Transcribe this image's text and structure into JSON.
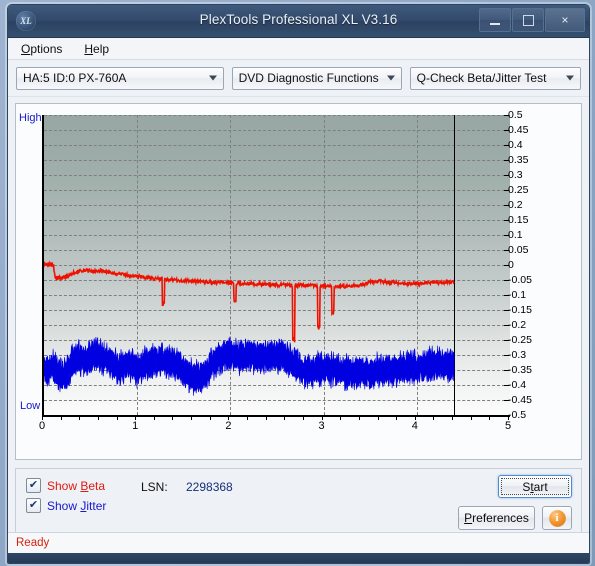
{
  "window": {
    "title": "PlexTools Professional XL V3.16",
    "logo_text": "XL",
    "minimize_label": "Minimize",
    "maximize_label": "Maximize",
    "close_label": "×"
  },
  "menu": {
    "items": [
      {
        "label": "Options",
        "mnemonic": "O"
      },
      {
        "label": "Help",
        "mnemonic": "H"
      }
    ]
  },
  "toolbar": {
    "drive_select": "HA:5 ID:0  PX-760A",
    "function_select": "DVD Diagnostic Functions",
    "test_select": "Q-Check Beta/Jitter Test"
  },
  "chart_labels": {
    "high": "High",
    "low": "Low"
  },
  "controls": {
    "show_beta_label": "Show Beta",
    "show_beta_mnemonic": "B",
    "show_beta_checked": "✔",
    "show_jitter_label": "Show Jitter",
    "show_jitter_mnemonic": "J",
    "show_jitter_checked": "✔",
    "lsn_label": "LSN:",
    "lsn_value": "2298368",
    "start_label": "Start",
    "start_mnemonic": "t",
    "preferences_label": "Preferences",
    "preferences_mnemonic": "P",
    "info_label": "i"
  },
  "status": {
    "text": "Ready"
  },
  "colors": {
    "beta": "#ee1100",
    "jitter": "#0000e0",
    "label_blue": "#1818cc",
    "status_red": "#d81f10",
    "titlebar": "#32496a"
  },
  "chart_data": {
    "type": "line",
    "title": "Q-Check Beta/Jitter Test",
    "xlabel": "",
    "ylabel": "",
    "xlim": [
      0,
      5
    ],
    "ylim": [
      -0.5,
      0.5
    ],
    "grid": true,
    "legend_position": "bottom-left",
    "y_ticks": [
      0.5,
      0.45,
      0.4,
      0.35,
      0.3,
      0.25,
      0.2,
      0.15,
      0.1,
      0.05,
      0,
      -0.05,
      -0.1,
      -0.15,
      -0.2,
      -0.25,
      -0.3,
      -0.35,
      -0.4,
      -0.45,
      -0.5
    ],
    "x_ticks": [
      0,
      1,
      2,
      3,
      4,
      5
    ],
    "data_end_x": 4.4,
    "axis_end_labels": {
      "top": "High",
      "bottom": "Low"
    },
    "series": [
      {
        "name": "Beta",
        "color": "#ee1100",
        "x": [
          0.0,
          0.05,
          0.08,
          0.1,
          0.12,
          0.15,
          0.2,
          0.25,
          0.3,
          0.35,
          0.4,
          0.45,
          0.5,
          0.55,
          0.6,
          0.65,
          0.7,
          0.75,
          0.8,
          0.85,
          0.9,
          0.95,
          1.0,
          1.1,
          1.2,
          1.3,
          1.4,
          1.5,
          1.6,
          1.7,
          1.8,
          1.9,
          2.0,
          2.1,
          2.2,
          2.3,
          2.4,
          2.5,
          2.6,
          2.7,
          2.8,
          2.9,
          3.0,
          3.1,
          3.2,
          3.3,
          3.4,
          3.5,
          3.6,
          3.7,
          3.8,
          3.9,
          4.0,
          4.1,
          4.2,
          4.3,
          4.4
        ],
        "values": [
          0.005,
          0.003,
          0.002,
          -0.002,
          -0.04,
          -0.045,
          -0.043,
          -0.04,
          -0.028,
          -0.022,
          -0.02,
          -0.018,
          -0.02,
          -0.022,
          -0.018,
          -0.02,
          -0.024,
          -0.028,
          -0.03,
          -0.032,
          -0.034,
          -0.036,
          -0.038,
          -0.042,
          -0.046,
          -0.048,
          -0.05,
          -0.052,
          -0.054,
          -0.056,
          -0.058,
          -0.058,
          -0.06,
          -0.062,
          -0.062,
          -0.064,
          -0.064,
          -0.066,
          -0.066,
          -0.068,
          -0.068,
          -0.07,
          -0.07,
          -0.072,
          -0.072,
          -0.07,
          -0.068,
          -0.056,
          -0.054,
          -0.058,
          -0.06,
          -0.062,
          -0.06,
          -0.06,
          -0.058,
          -0.058,
          -0.058
        ],
        "noise_amplitude": 0.012,
        "dropouts": [
          {
            "x": 2.68,
            "depth": -0.26
          },
          {
            "x": 2.95,
            "depth": -0.22
          },
          {
            "x": 3.1,
            "depth": -0.17
          },
          {
            "x": 1.28,
            "depth": -0.14
          },
          {
            "x": 2.05,
            "depth": -0.13
          }
        ]
      },
      {
        "name": "Jitter",
        "color": "#0000e0",
        "x": [
          0.0,
          0.05,
          0.1,
          0.15,
          0.2,
          0.25,
          0.3,
          0.35,
          0.4,
          0.45,
          0.5,
          0.55,
          0.6,
          0.65,
          0.7,
          0.75,
          0.8,
          0.85,
          0.9,
          0.95,
          1.0,
          1.1,
          1.2,
          1.3,
          1.4,
          1.5,
          1.6,
          1.7,
          1.8,
          1.9,
          2.0,
          2.1,
          2.2,
          2.3,
          2.4,
          2.5,
          2.6,
          2.7,
          2.8,
          2.9,
          3.0,
          3.1,
          3.2,
          3.3,
          3.4,
          3.5,
          3.6,
          3.7,
          3.8,
          3.9,
          4.0,
          4.1,
          4.2,
          4.3,
          4.4
        ],
        "values": [
          -0.345,
          -0.35,
          -0.335,
          -0.36,
          -0.375,
          -0.36,
          -0.33,
          -0.315,
          -0.31,
          -0.32,
          -0.305,
          -0.3,
          -0.305,
          -0.315,
          -0.325,
          -0.33,
          -0.345,
          -0.34,
          -0.33,
          -0.34,
          -0.35,
          -0.33,
          -0.32,
          -0.315,
          -0.33,
          -0.35,
          -0.375,
          -0.37,
          -0.33,
          -0.305,
          -0.3,
          -0.305,
          -0.3,
          -0.31,
          -0.305,
          -0.3,
          -0.31,
          -0.33,
          -0.36,
          -0.35,
          -0.345,
          -0.35,
          -0.355,
          -0.36,
          -0.355,
          -0.36,
          -0.35,
          -0.345,
          -0.35,
          -0.345,
          -0.34,
          -0.335,
          -0.33,
          -0.335,
          -0.335
        ],
        "band_half_width": 0.038,
        "noise_amplitude": 0.03
      }
    ]
  }
}
